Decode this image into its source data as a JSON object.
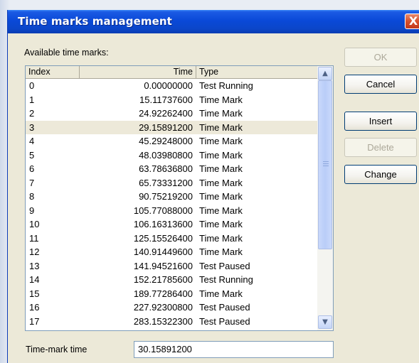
{
  "window": {
    "title": "Time marks management",
    "close_glyph": "X"
  },
  "labels": {
    "available": "Available time marks:",
    "time_mark_time": "Time-mark time"
  },
  "columns": {
    "index": "Index",
    "time": "Time",
    "type": "Type"
  },
  "rows": [
    {
      "index": "0",
      "time": "0.00000000",
      "type": "Test Running"
    },
    {
      "index": "1",
      "time": "15.11737600",
      "type": "Time Mark"
    },
    {
      "index": "2",
      "time": "24.92262400",
      "type": "Time Mark"
    },
    {
      "index": "3",
      "time": "29.15891200",
      "type": "Time Mark",
      "selected": true
    },
    {
      "index": "4",
      "time": "45.29248000",
      "type": "Time Mark"
    },
    {
      "index": "5",
      "time": "48.03980800",
      "type": "Time Mark"
    },
    {
      "index": "6",
      "time": "63.78636800",
      "type": "Time Mark"
    },
    {
      "index": "7",
      "time": "65.73331200",
      "type": "Time Mark"
    },
    {
      "index": "8",
      "time": "90.75219200",
      "type": "Time Mark"
    },
    {
      "index": "9",
      "time": "105.77088000",
      "type": "Time Mark"
    },
    {
      "index": "10",
      "time": "106.16313600",
      "type": "Time Mark"
    },
    {
      "index": "11",
      "time": "125.15526400",
      "type": "Time Mark"
    },
    {
      "index": "12",
      "time": "140.91449600",
      "type": "Time Mark"
    },
    {
      "index": "13",
      "time": "141.94521600",
      "type": "Test Paused"
    },
    {
      "index": "14",
      "time": "152.21785600",
      "type": "Test Running"
    },
    {
      "index": "15",
      "time": "189.77286400",
      "type": "Time Mark"
    },
    {
      "index": "16",
      "time": "227.92300800",
      "type": "Test Paused"
    },
    {
      "index": "17",
      "time": "283.15322300",
      "type": "Test Paused"
    }
  ],
  "buttons": {
    "ok": "OK",
    "cancel": "Cancel",
    "insert": "Insert",
    "delete": "Delete",
    "change": "Change"
  },
  "time_input_value": "30.15891200",
  "icons": {
    "scroll_up": "chevron-up-icon",
    "scroll_down": "chevron-down-icon",
    "close": "close-icon"
  },
  "colors": {
    "titlebar": "#0a49d8",
    "dialog_bg": "#ece9d8",
    "selected_row": "#ede9d9",
    "close_button": "#d6502c"
  }
}
